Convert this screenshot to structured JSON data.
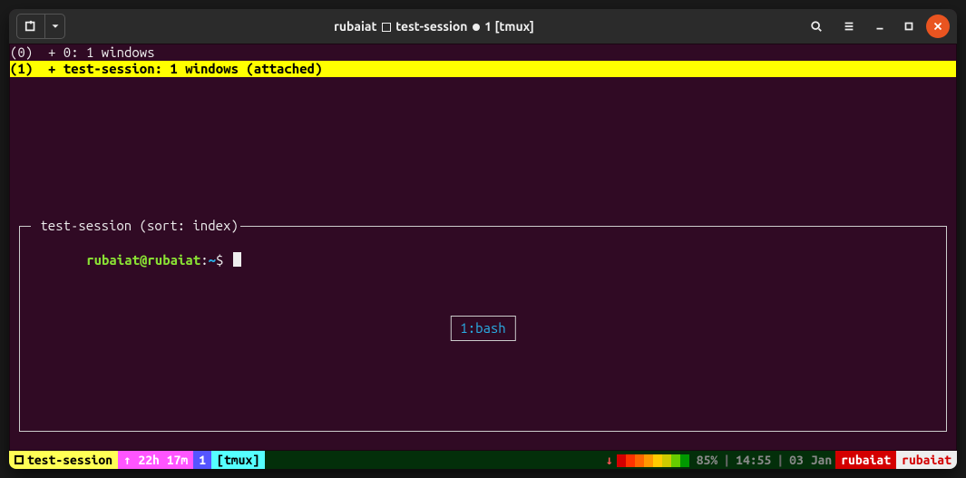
{
  "titlebar": {
    "title_user": "rubaiat",
    "title_session": "test-session",
    "title_win": "1 [tmux]"
  },
  "session_list": {
    "rows": [
      {
        "idx": "(0)",
        "text": "+ 0: 1 windows",
        "selected": false
      },
      {
        "idx": "(1)",
        "text": "+ test-session: 1 windows (attached)",
        "selected": true
      }
    ]
  },
  "preview": {
    "caption": " test-session (sort: index)",
    "prompt_user": "rubaiat@rubaiat",
    "prompt_path": "~",
    "window_tag": "1:bash"
  },
  "status": {
    "session_name": "test-session",
    "uptime_arrow": "↑",
    "uptime": "22h 17m",
    "win_index": "1",
    "win_name": "[tmux]",
    "battery_pct": "85%",
    "time": "14:55",
    "date": "03 Jan",
    "user1": "rubaiat",
    "user2": "rubaiat"
  },
  "colors": {
    "colorbar": [
      "#d40000",
      "#ff3300",
      "#ff6600",
      "#ff9900",
      "#ffcc00",
      "#cccc00",
      "#66cc00",
      "#009900"
    ]
  }
}
